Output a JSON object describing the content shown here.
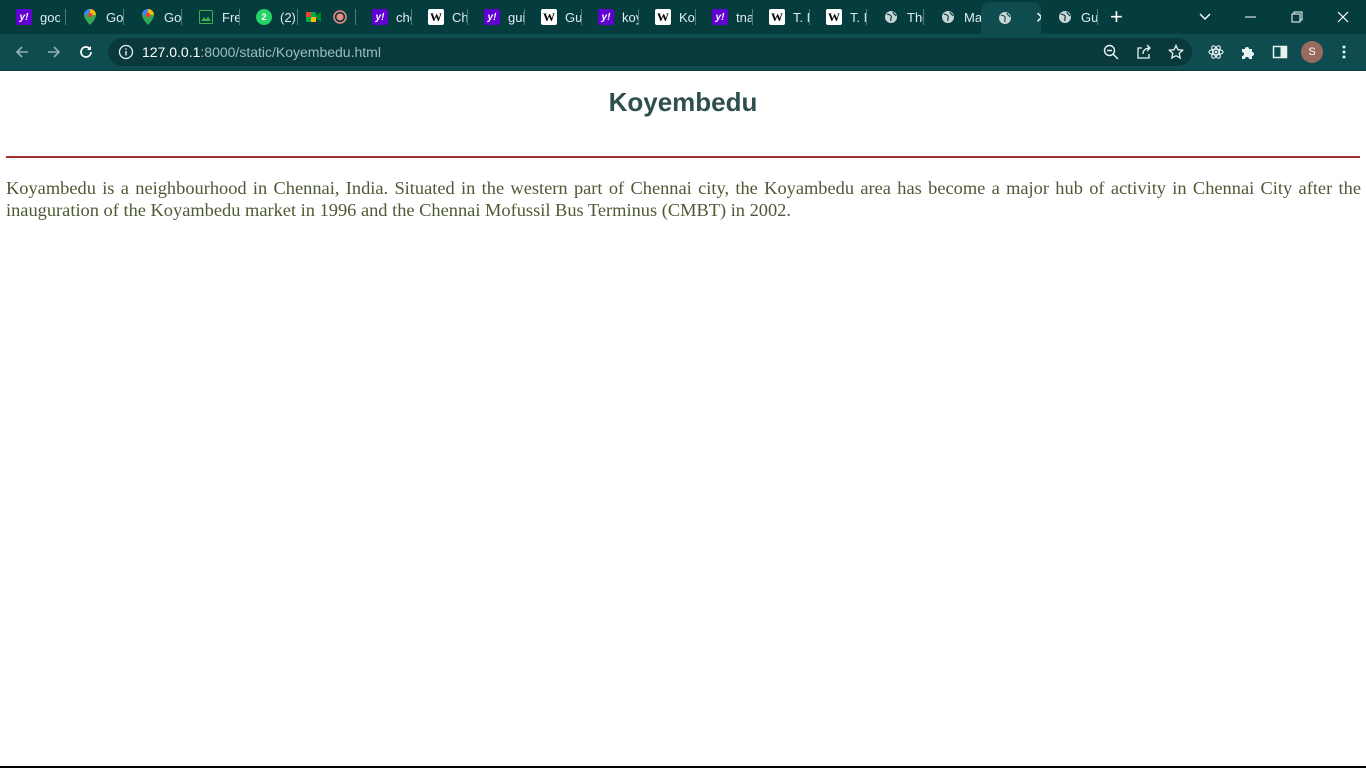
{
  "browser": {
    "tabs": [
      {
        "icon": "yahoo-icon",
        "glyph": "y!",
        "label": "goo"
      },
      {
        "icon": "google-maps-icon",
        "glyph": "",
        "label": "Goo"
      },
      {
        "icon": "google-maps-icon",
        "glyph": "",
        "label": "Goo"
      },
      {
        "icon": "image-icon",
        "glyph": "",
        "label": "Free"
      },
      {
        "icon": "whatsapp-icon",
        "glyph": "2",
        "label": "(2)"
      },
      {
        "icon": "google-meet-icon",
        "glyph": "",
        "label": ""
      },
      {
        "icon": "record-icon",
        "glyph": "",
        "label": ""
      },
      {
        "icon": "yahoo-icon",
        "glyph": "y!",
        "label": "che"
      },
      {
        "icon": "wikipedia-icon",
        "glyph": "W",
        "label": "Che"
      },
      {
        "icon": "yahoo-icon",
        "glyph": "y!",
        "label": "gui"
      },
      {
        "icon": "wikipedia-icon",
        "glyph": "W",
        "label": "Gui"
      },
      {
        "icon": "yahoo-icon",
        "glyph": "y!",
        "label": "koy"
      },
      {
        "icon": "wikipedia-icon",
        "glyph": "W",
        "label": "Koy"
      },
      {
        "icon": "yahoo-icon",
        "glyph": "y!",
        "label": "tna"
      },
      {
        "icon": "wikipedia-icon",
        "glyph": "W",
        "label": "T. N"
      },
      {
        "icon": "wikipedia-icon",
        "glyph": "W",
        "label": "T. N"
      },
      {
        "icon": "globe-icon",
        "glyph": "",
        "label": "The"
      },
      {
        "icon": "globe-icon",
        "glyph": "",
        "label": "Ma"
      },
      {
        "icon": "globe-icon",
        "glyph": "",
        "label": "",
        "active": true
      },
      {
        "icon": "globe-icon",
        "glyph": "",
        "label": "Gui"
      }
    ],
    "address": {
      "host": "127.0.0.1",
      "rest": ":8000/static/Koyembedu.html"
    },
    "profile_initial": "S"
  },
  "page": {
    "heading": "Koyembedu",
    "paragraph": "Koyambedu is a neighbourhood in Chennai, India. Situated in the western part of Chennai city, the Koyambedu area has become a major hub of activity in Chennai City after the inauguration of the Koyambedu market in 1996 and the Chennai Mofussil Bus Terminus (CMBT) in 2002."
  },
  "colors": {
    "chrome_dark": "#053d3e",
    "chrome_toolbar": "#0e4c4f",
    "heading": "#2f4f4f",
    "rule": "#a0302f",
    "paragraph": "#4e5a35"
  }
}
